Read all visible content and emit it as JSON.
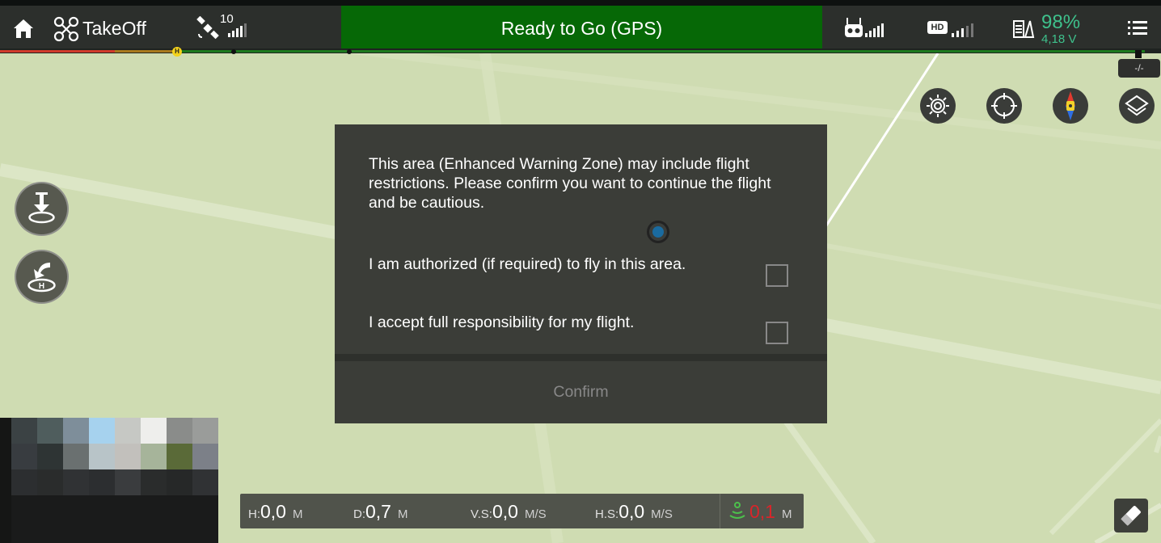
{
  "topbar": {
    "takeoff_label": "TakeOff",
    "satellite_count": "10",
    "status_text": "Ready to Go (GPS)",
    "battery_percent": "98%",
    "battery_voltage": "4,18 V",
    "home_marker": "H"
  },
  "map": {
    "coordinate_badge": "-/-"
  },
  "dialog": {
    "message": "This area (Enhanced Warning Zone) may include flight restrictions. Please confirm you want to continue the flight and be cautious.",
    "check_authorized": "I am authorized (if required) to fly in this area.",
    "check_responsibility": "I accept full responsibility for my flight.",
    "confirm_label": "Confirm"
  },
  "telemetry": {
    "h_label": "H:",
    "h_value": "0,0",
    "h_unit": "M",
    "d_label": "D:",
    "d_value": "0,7",
    "d_unit": "M",
    "vs_label": "V.S:",
    "vs_value": "0,0",
    "vs_unit": "M/S",
    "hs_label": "H.S:",
    "hs_value": "0,0",
    "hs_unit": "M/S",
    "vps_value": "0,1",
    "vps_unit": "M"
  },
  "icons": {
    "home": "home-icon",
    "drone": "drone-icon",
    "satellite": "satellite-icon",
    "remote": "remote-controller-icon",
    "hd": "hd-video-link-icon",
    "battery": "battery-icon",
    "menu": "menu-list-icon",
    "camera_settings": "camera-settings-icon",
    "locate": "locate-crosshair-icon",
    "compass": "compass-icon",
    "layers": "map-layers-icon",
    "takeoff": "auto-takeoff-icon",
    "return_home": "return-to-home-icon",
    "vision": "vision-position-icon",
    "eraser": "eraser-icon"
  },
  "colors": {
    "status_green": "#066806",
    "battery_green": "#3ec18c",
    "vps_red": "#d9252a",
    "map_bg": "#cfdcb2"
  }
}
